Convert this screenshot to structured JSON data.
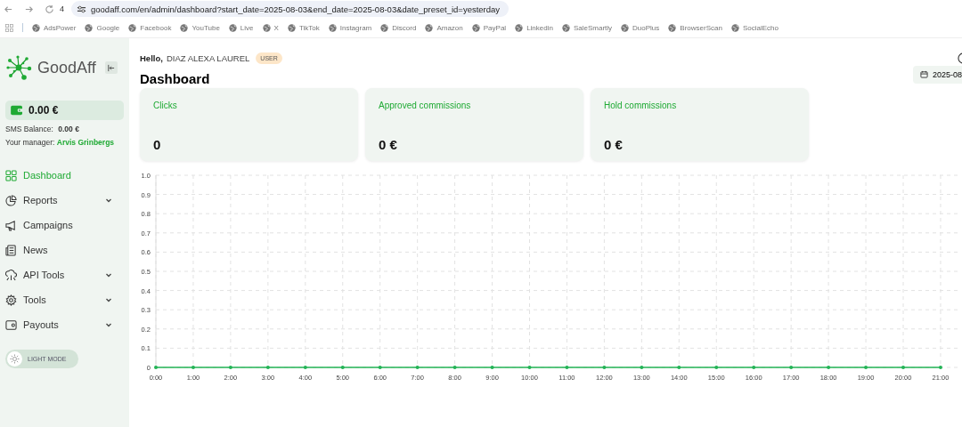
{
  "browser": {
    "tab_count": "4",
    "url": "goodaff.com/en/admin/dashboard?start_date=2025-08-03&end_date=2025-08-03&date_preset_id=yesterday",
    "bookmarks": [
      "AdsPower",
      "Google",
      "Facebook",
      "YouTube",
      "Live",
      "X",
      "TikTok",
      "Instagram",
      "Discord",
      "Amazon",
      "PayPal",
      "Linkedin",
      "SaleSmartly",
      "DuoPlus",
      "BrowserScan",
      "SocialEcho"
    ]
  },
  "sidebar": {
    "logo": "GoodAff",
    "balance": "0.00 €",
    "sms_label": "SMS Balance:",
    "sms_value": "0.00 €",
    "manager_label": "Your manager:",
    "manager_name": "Arvis Grinbergs",
    "items": [
      {
        "kind": "dashboard",
        "label": "Dashboard",
        "selected": true,
        "submenu": false
      },
      {
        "kind": "reports",
        "label": "Reports",
        "selected": false,
        "submenu": true
      },
      {
        "kind": "campaigns",
        "label": "Campaigns",
        "selected": false,
        "submenu": false
      },
      {
        "kind": "news",
        "label": "News",
        "selected": false,
        "submenu": false
      },
      {
        "kind": "api",
        "label": "API Tools",
        "selected": false,
        "submenu": true
      },
      {
        "kind": "tools",
        "label": "Tools",
        "selected": false,
        "submenu": true
      },
      {
        "kind": "payouts",
        "label": "Payouts",
        "selected": false,
        "submenu": true
      }
    ],
    "theme_toggle": "LIGHT MODE"
  },
  "header": {
    "greeting": "Hello,",
    "user_name": "DIAZ ALEXA LAUREL",
    "role": "USER",
    "title": "Dashboard",
    "date_range": "2025-08"
  },
  "stats": [
    {
      "label": "Clicks",
      "value": "0"
    },
    {
      "label": "Approved commissions",
      "value": "0 €"
    },
    {
      "label": "Hold commissions",
      "value": "0 €"
    }
  ],
  "chart_data": {
    "type": "line",
    "categories": [
      "0:00",
      "1:00",
      "2:00",
      "3:00",
      "4:00",
      "5:00",
      "6:00",
      "7:00",
      "8:00",
      "9:00",
      "10:00",
      "11:00",
      "12:00",
      "13:00",
      "14:00",
      "15:00",
      "16:00",
      "17:00",
      "18:00",
      "19:00",
      "20:00",
      "21:00"
    ],
    "series": [
      {
        "color": "#22b355",
        "values": [
          0,
          0,
          0,
          0,
          0,
          0,
          0,
          0,
          0,
          0,
          0,
          0,
          0,
          0,
          0,
          0,
          0,
          0,
          0,
          0,
          0,
          0
        ]
      }
    ],
    "grid": true,
    "ylim": [
      0,
      1
    ],
    "yticks": [
      0,
      0.1,
      0.2,
      0.3,
      0.4,
      0.5,
      0.6,
      0.7,
      0.8,
      0.9,
      {
        "value": 1,
        "label": "1.0"
      }
    ]
  }
}
